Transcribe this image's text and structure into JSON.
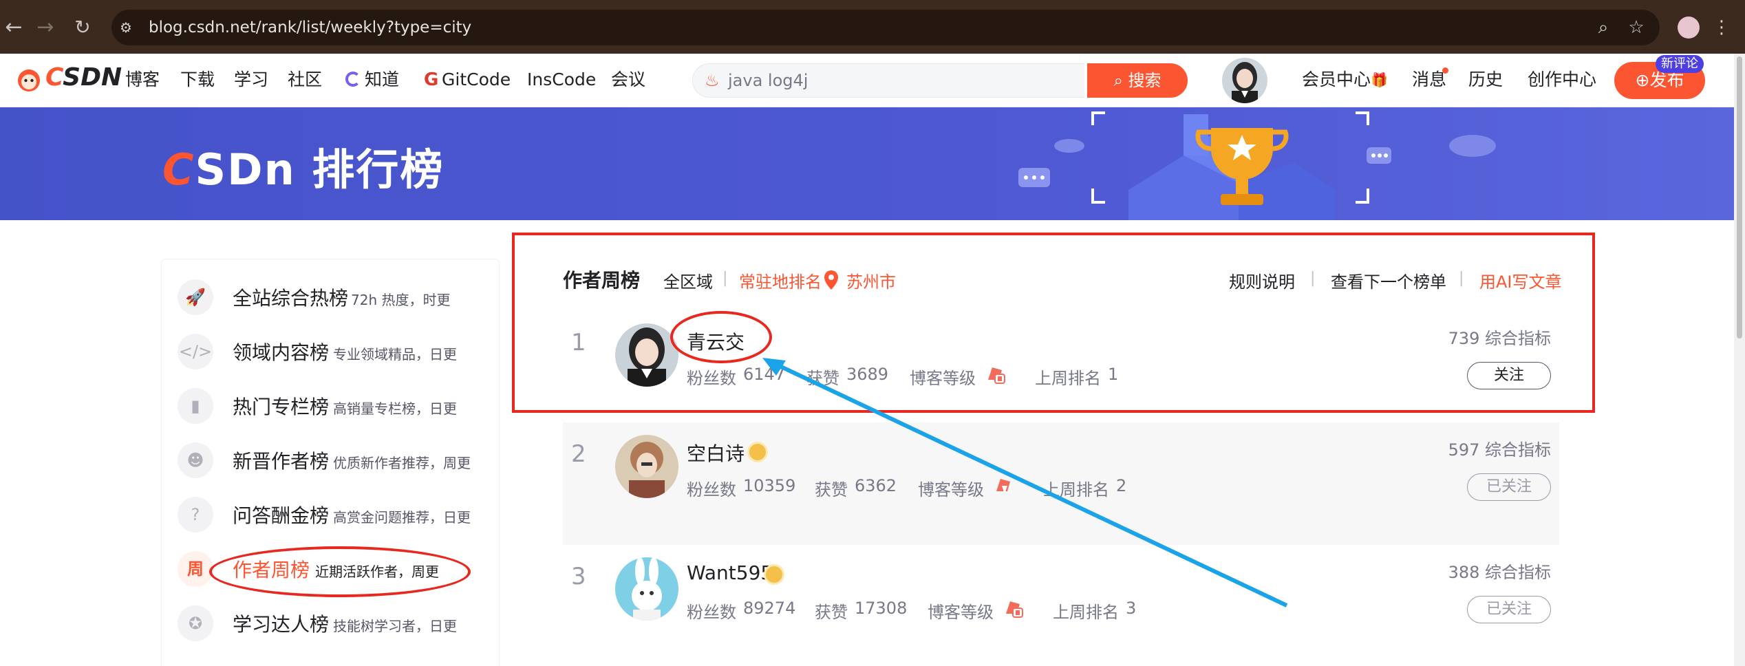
{
  "browser": {
    "url": "blog.csdn.net/rank/list/weekly?type=city"
  },
  "topnav": {
    "logo": "CSDN",
    "items": [
      "博客",
      "下载",
      "学习",
      "社区",
      "知道",
      "GitCode",
      "InsCode",
      "会议"
    ],
    "search_placeholder": "java log4j",
    "search_button": "搜索",
    "right_items": [
      "会员中心",
      "消息",
      "历史",
      "创作中心"
    ],
    "publish_label": "发布",
    "publish_badge": "新评论"
  },
  "banner": {
    "title_c": "C",
    "title_rest": "SDn 排行榜"
  },
  "sidebar": {
    "items": [
      {
        "title": "全站综合热榜",
        "desc": "72h 热度，时更",
        "icon": "rocket-icon"
      },
      {
        "title": "领域内容榜",
        "desc": "专业领域精品，日更",
        "icon": "code-icon"
      },
      {
        "title": "热门专栏榜",
        "desc": "高销量专栏榜，日更",
        "icon": "book-icon"
      },
      {
        "title": "新晋作者榜",
        "desc": "优质新作者推荐，周更",
        "icon": "person-icon"
      },
      {
        "title": "问答酬金榜",
        "desc": "高赏金问题推荐，日更",
        "icon": "question-icon"
      },
      {
        "title": "作者周榜",
        "desc": "近期活跃作者，周更",
        "icon": "week-icon",
        "icon_text": "周"
      },
      {
        "title": "学习达人榜",
        "desc": "技能树学习者，日更",
        "icon": "medal-icon"
      }
    ]
  },
  "list": {
    "title": "作者周榜",
    "scope_all": "全区域",
    "scope_local": "常驻地排名",
    "city": "苏州市",
    "rules": "规则说明",
    "next_list": "查看下一个榜单",
    "ai_write": "用AI写文章",
    "rows": [
      {
        "rank": "1",
        "name": "青云交",
        "fans_label": "粉丝数",
        "fans": "6147",
        "likes_label": "获赞",
        "likes": "3689",
        "level_label": "博客等级",
        "last_label": "上周排名",
        "last": "1",
        "score": "739 综合指标",
        "follow": "关注"
      },
      {
        "rank": "2",
        "name": "空白诗",
        "fans_label": "粉丝数",
        "fans": "10359",
        "likes_label": "获赞",
        "likes": "6362",
        "level_label": "博客等级",
        "last_label": "上周排名",
        "last": "2",
        "score": "597 综合指标",
        "follow": "已关注"
      },
      {
        "rank": "3",
        "name": "Want595",
        "fans_label": "粉丝数",
        "fans": "89274",
        "likes_label": "获赞",
        "likes": "17308",
        "level_label": "博客等级",
        "last_label": "上周排名",
        "last": "3",
        "score": "388 综合指标",
        "follow": "已关注"
      }
    ]
  },
  "colors": {
    "brand": "#fc5531",
    "banner": "#4a56cf",
    "annotation_red": "#e8281e",
    "annotation_blue": "#1aa3e8"
  }
}
